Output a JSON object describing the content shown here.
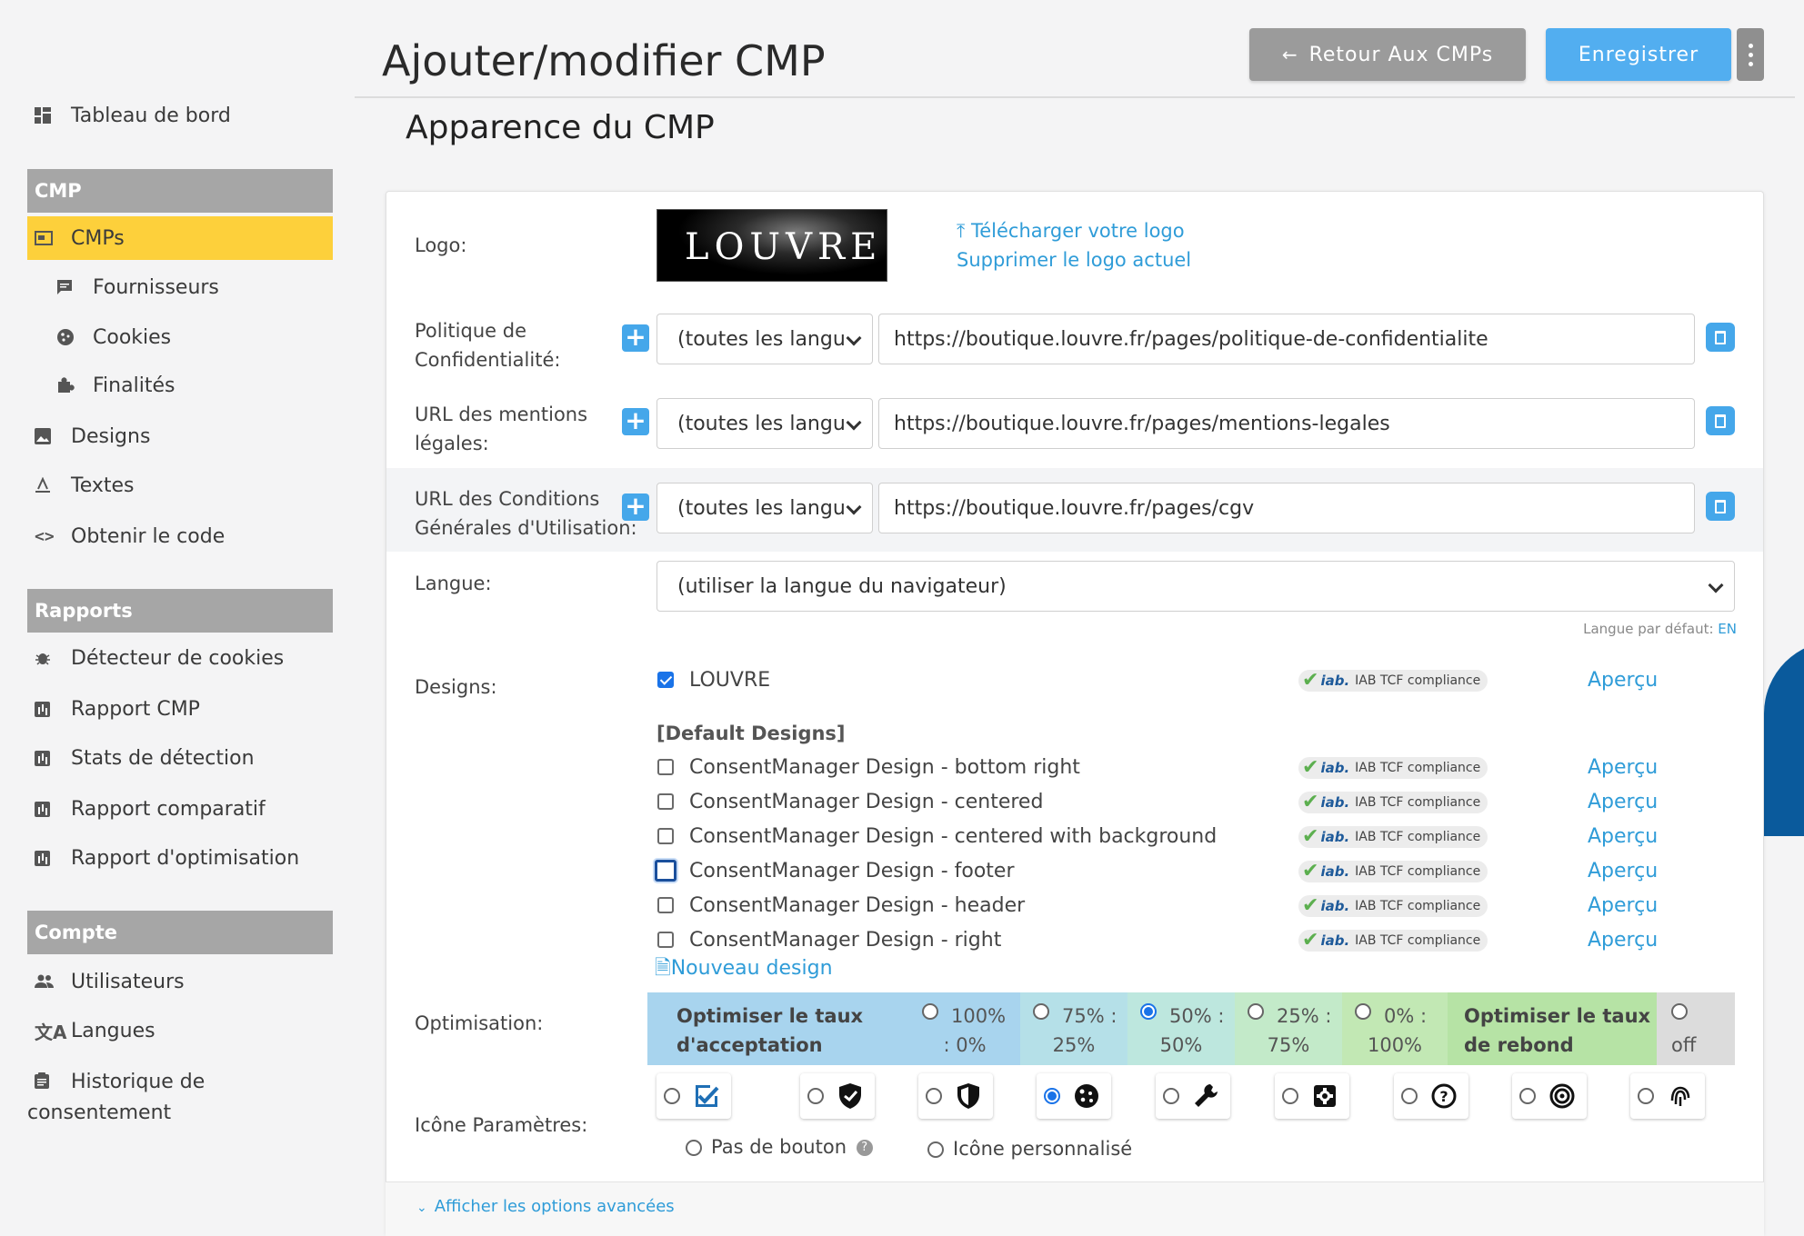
{
  "sidebar": {
    "dashboard": "Tableau de bord",
    "cmp_section": "CMP",
    "cmps": "CMPs",
    "vendors": "Fournisseurs",
    "cookies": "Cookies",
    "purposes": "Finalités",
    "designs": "Designs",
    "texts": "Textes",
    "get_code": "Obtenir le code",
    "reports_section": "Rapports",
    "cookie_crawler": "Détecteur de cookies",
    "cmp_report": "Rapport CMP",
    "detection_stats": "Stats de détection",
    "comparative_report": "Rapport comparatif",
    "optimization_report": "Rapport d'optimisation",
    "account_section": "Compte",
    "users": "Utilisateurs",
    "languages": "Langues",
    "consent_history_1": "Historique de",
    "consent_history_2": "consentement",
    "active_color": "#fdd03b"
  },
  "header": {
    "title": "Ajouter/modifier CMP",
    "back_button": "Retour Aux CMPs",
    "save_button": "Enregistrer",
    "section_title": "Apparence du CMP"
  },
  "form": {
    "logo_label": "Logo:",
    "logo_text": "LOUVRE",
    "upload_logo": "Télécharger votre logo",
    "delete_logo": "Supprimer le logo actuel",
    "privacy_label_1": "Politique de",
    "privacy_label_2": "Confidentialité:",
    "privacy_lang": "(toutes les langu",
    "privacy_url": "https://boutique.louvre.fr/pages/politique-de-confidentialite",
    "legal_label_1": "URL des mentions",
    "legal_label_2": "légales:",
    "legal_lang": "(toutes les langu",
    "legal_url": "https://boutique.louvre.fr/pages/mentions-legales",
    "terms_label_1": "URL des Conditions",
    "terms_label_2": "Générales d'Utilisation:",
    "terms_lang": "(toutes les langu",
    "terms_url": "https://boutique.louvre.fr/pages/cgv",
    "language_label": "Langue:",
    "language_value": "(utiliser la langue du navigateur)",
    "default_lang_prefix": "Langue par défaut: ",
    "default_lang_code": "EN",
    "designs_label": "Designs:",
    "default_designs_header": "[Default Designs]",
    "iab_label": "IAB TCF compliance",
    "iab_logo": "iab.",
    "preview": "Aperçu",
    "designs": [
      {
        "name": "LOUVRE",
        "checked": true
      },
      {
        "name": "ConsentManager Design - bottom right",
        "checked": false
      },
      {
        "name": "ConsentManager Design - centered",
        "checked": false
      },
      {
        "name": "ConsentManager Design - centered with background",
        "checked": false
      },
      {
        "name": "ConsentManager Design - footer",
        "checked": false,
        "focused": true
      },
      {
        "name": "ConsentManager Design - header",
        "checked": false
      },
      {
        "name": "ConsentManager Design - right",
        "checked": false
      }
    ],
    "new_design": "Nouveau design",
    "optimisation_label": "Optimisation:",
    "opt_left_1": "Optimiser le taux",
    "opt_left_2": "d'acceptation",
    "opt_right_1": "Optimiser le taux",
    "opt_right_2": "de rebond",
    "opt_options": [
      {
        "l1": "100%",
        "l2": ": 0%",
        "color": "#a8d4ee",
        "selected": false
      },
      {
        "l1": "75% :",
        "l2": "25%",
        "color": "#b5e0e8",
        "selected": false
      },
      {
        "l1": "50% :",
        "l2": "50%",
        "color": "#bde7de",
        "selected": true
      },
      {
        "l1": "25% :",
        "l2": "75%",
        "color": "#c3eac9",
        "selected": false
      },
      {
        "l1": "0% :",
        "l2": "100%",
        "color": "#c2e8b4",
        "selected": false
      }
    ],
    "opt_off": "off",
    "settings_icon_label": "Icône Paramètres:",
    "settings_icons": [
      {
        "icon": "checklist-icon",
        "selected": false
      },
      {
        "icon": "shield-check-icon",
        "selected": false
      },
      {
        "icon": "shield-half-icon",
        "selected": false
      },
      {
        "icon": "cookie-icon",
        "selected": true
      },
      {
        "icon": "wrench-icon",
        "selected": false
      },
      {
        "icon": "gear-square-icon",
        "selected": false
      },
      {
        "icon": "question-circle-icon",
        "selected": false
      },
      {
        "icon": "fingerprint-round-icon",
        "selected": false
      },
      {
        "icon": "fingerprint-icon",
        "selected": false
      }
    ],
    "no_button": "Pas de bouton",
    "custom_icon": "Icône personnalisé",
    "advanced_options": "Afficher les options avancées"
  }
}
